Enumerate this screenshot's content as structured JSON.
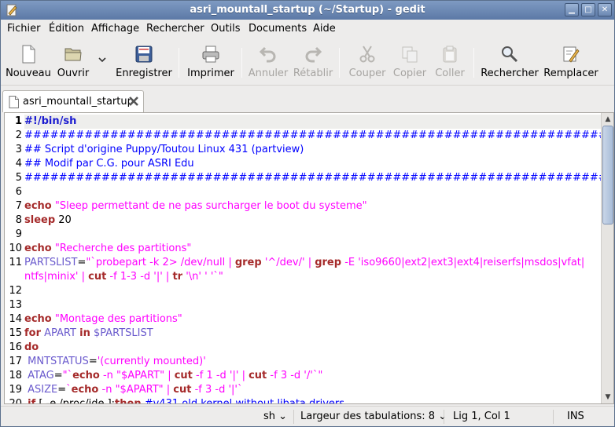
{
  "window": {
    "title": "asri_mountall_startup (~/Startup) - gedit"
  },
  "menubar": {
    "items": [
      {
        "label": "Fichier"
      },
      {
        "label": "Édition"
      },
      {
        "label": "Affichage"
      },
      {
        "label": "Rechercher"
      },
      {
        "label": "Outils"
      },
      {
        "label": "Documents"
      },
      {
        "label": "Aide"
      }
    ]
  },
  "toolbar": {
    "new_label": "Nouveau",
    "open_label": "Ouvrir",
    "save_label": "Enregistrer",
    "print_label": "Imprimer",
    "undo_label": "Annuler",
    "redo_label": "Rétablir",
    "cut_label": "Couper",
    "copy_label": "Copier",
    "paste_label": "Coller",
    "find_label": "Rechercher",
    "replace_label": "Remplacer"
  },
  "tab": {
    "label": "asri_mountall_startup"
  },
  "editor": {
    "line_numbers": [
      "1",
      "2",
      "3",
      "4",
      "5",
      "6",
      "7",
      "8",
      "9",
      "10",
      "11",
      "",
      "12",
      "13",
      "14",
      "15",
      "16",
      "17",
      "18",
      "19",
      "20"
    ],
    "lines": [
      [
        [
          "shebang",
          "#!/bin/sh"
        ]
      ],
      [
        [
          "comment",
          "####################################################################"
        ]
      ],
      [
        [
          "comment",
          "## Script d'origine Puppy/Toutou Linux 431 (partview)"
        ]
      ],
      [
        [
          "comment",
          "## Modif par C.G. pour ASRI Edu"
        ]
      ],
      [
        [
          "comment",
          "####################################################################"
        ]
      ],
      [],
      [
        [
          "kw",
          "echo"
        ],
        [
          "plain",
          " "
        ],
        [
          "str",
          "\"Sleep permettant de ne pas surcharger le boot du systeme\""
        ]
      ],
      [
        [
          "kw",
          "sleep"
        ],
        [
          "plain",
          " 20"
        ]
      ],
      [],
      [
        [
          "kw",
          "echo"
        ],
        [
          "plain",
          " "
        ],
        [
          "str",
          "\"Recherche des partitions\""
        ]
      ],
      [
        [
          "var",
          "PARTSLIST"
        ],
        [
          "plain",
          "="
        ],
        [
          "str",
          "\"`probepart -k 2> /dev/null | "
        ],
        [
          "kw",
          "grep"
        ],
        [
          "str",
          " '^/dev/' | "
        ],
        [
          "kw",
          "grep"
        ],
        [
          "str",
          " -E 'iso9660|ext2|ext3|ext4|reiserfs|msdos|vfat|"
        ]
      ],
      [
        [
          "str",
          "ntfs|minix' | "
        ],
        [
          "kw",
          "cut"
        ],
        [
          "str",
          " -f 1-3 -d '|' | "
        ],
        [
          "kw",
          "tr"
        ],
        [
          "str",
          " '\\n' ' '`\""
        ]
      ],
      [],
      [],
      [
        [
          "kw",
          "echo"
        ],
        [
          "plain",
          " "
        ],
        [
          "str",
          "\"Montage des partitions\""
        ]
      ],
      [
        [
          "kw",
          "for"
        ],
        [
          "plain",
          " "
        ],
        [
          "var",
          "APART"
        ],
        [
          "plain",
          " "
        ],
        [
          "kw",
          "in"
        ],
        [
          "plain",
          " "
        ],
        [
          "var",
          "$PARTSLIST"
        ]
      ],
      [
        [
          "kw",
          "do"
        ]
      ],
      [
        [
          "plain",
          " "
        ],
        [
          "var",
          "MNTSTATUS"
        ],
        [
          "plain",
          "="
        ],
        [
          "str",
          "'(currently mounted)'"
        ]
      ],
      [
        [
          "plain",
          " "
        ],
        [
          "var",
          "ATAG"
        ],
        [
          "plain",
          "="
        ],
        [
          "str",
          "\"`"
        ],
        [
          "kw",
          "echo"
        ],
        [
          "str",
          " -n \"$APART\" | "
        ],
        [
          "kw",
          "cut"
        ],
        [
          "str",
          " -f 1 -d '|' | "
        ],
        [
          "kw",
          "cut"
        ],
        [
          "str",
          " -f 3 -d '/'`\""
        ]
      ],
      [
        [
          "plain",
          " "
        ],
        [
          "var",
          "ASIZE"
        ],
        [
          "plain",
          "="
        ],
        [
          "str",
          "`"
        ],
        [
          "kw",
          "echo"
        ],
        [
          "str",
          " -n \"$APART\" | "
        ],
        [
          "kw",
          "cut"
        ],
        [
          "str",
          " -f 3 -d '|'`"
        ]
      ],
      [
        [
          "plain",
          " "
        ],
        [
          "kw",
          "if"
        ],
        [
          "plain",
          " [ -e /proc/ide ];"
        ],
        [
          "kw",
          "then"
        ],
        [
          "comment",
          " #v431 old kernel without libata drivers"
        ]
      ]
    ]
  },
  "statusbar": {
    "language": "sh",
    "tab_width": "Largeur des tabulations:  8",
    "position": "Lig 1, Col 1",
    "mode": "INS"
  },
  "icons": [
    "gedit-icon",
    "minimize-icon",
    "maximize-icon",
    "close-icon",
    "new-document-icon",
    "open-folder-icon",
    "dropdown-arrow-icon",
    "save-icon",
    "print-icon",
    "undo-icon",
    "redo-icon",
    "cut-icon",
    "copy-icon",
    "paste-icon",
    "find-icon",
    "replace-icon",
    "text-file-icon",
    "tab-close-icon",
    "scroll-up-icon",
    "scroll-down-icon"
  ]
}
